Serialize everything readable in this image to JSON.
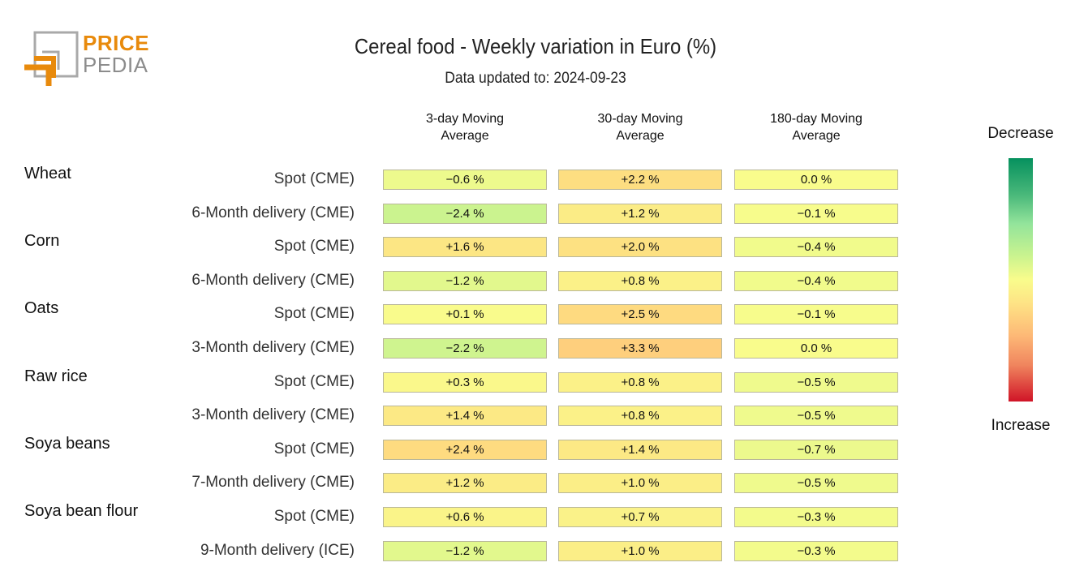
{
  "logo": {
    "line1": "PRICE",
    "line2": "PEDIA"
  },
  "chart_data": {
    "type": "heatmap",
    "title": "Cereal food - Weekly variation in Euro (%)",
    "subtitle": "Data updated to: 2024-09-23",
    "columns": [
      "3-day Moving\nAverage",
      "30-day Moving\nAverage",
      "180-day Moving\nAverage"
    ],
    "column_lines": [
      [
        "3-day Moving",
        "Average"
      ],
      [
        "30-day Moving",
        "Average"
      ],
      [
        "180-day Moving",
        "Average"
      ]
    ],
    "groups": [
      {
        "name": "Wheat",
        "rows": [
          0,
          1
        ]
      },
      {
        "name": "Corn",
        "rows": [
          2,
          3
        ]
      },
      {
        "name": "Oats",
        "rows": [
          4,
          5
        ]
      },
      {
        "name": "Raw rice",
        "rows": [
          6,
          7
        ]
      },
      {
        "name": "Soya beans",
        "rows": [
          8,
          9
        ]
      },
      {
        "name": "Soya bean flour",
        "rows": [
          10,
          11
        ]
      }
    ],
    "rows": [
      {
        "label": "Spot (CME)",
        "values": [
          -0.6,
          2.2,
          0.0
        ],
        "text": [
          "−0.6 %",
          "+2.2 %",
          "0.0 %"
        ]
      },
      {
        "label": "6-Month delivery (CME)",
        "values": [
          -2.4,
          1.2,
          -0.1
        ],
        "text": [
          "−2.4 %",
          "+1.2 %",
          "−0.1 %"
        ]
      },
      {
        "label": "Spot (CME)",
        "values": [
          1.6,
          2.0,
          -0.4
        ],
        "text": [
          "+1.6 %",
          "+2.0 %",
          "−0.4 %"
        ]
      },
      {
        "label": "6-Month delivery (CME)",
        "values": [
          -1.2,
          0.8,
          -0.4
        ],
        "text": [
          "−1.2 %",
          "+0.8 %",
          "−0.4 %"
        ]
      },
      {
        "label": "Spot (CME)",
        "values": [
          0.1,
          2.5,
          -0.1
        ],
        "text": [
          "+0.1 %",
          "+2.5 %",
          "−0.1 %"
        ]
      },
      {
        "label": "3-Month delivery (CME)",
        "values": [
          -2.2,
          3.3,
          0.0
        ],
        "text": [
          "−2.2 %",
          "+3.3 %",
          "0.0 %"
        ]
      },
      {
        "label": "Spot (CME)",
        "values": [
          0.3,
          0.8,
          -0.5
        ],
        "text": [
          "+0.3 %",
          "+0.8 %",
          "−0.5 %"
        ]
      },
      {
        "label": "3-Month delivery (CME)",
        "values": [
          1.4,
          0.8,
          -0.5
        ],
        "text": [
          "+1.4 %",
          "+0.8 %",
          "−0.5 %"
        ]
      },
      {
        "label": "Spot (CME)",
        "values": [
          2.4,
          1.4,
          -0.7
        ],
        "text": [
          "+2.4 %",
          "+1.4 %",
          "−0.7 %"
        ]
      },
      {
        "label": "7-Month delivery (CME)",
        "values": [
          1.2,
          1.0,
          -0.5
        ],
        "text": [
          "+1.2 %",
          "+1.0 %",
          "−0.5 %"
        ]
      },
      {
        "label": "Spot (CME)",
        "values": [
          0.6,
          0.7,
          -0.3
        ],
        "text": [
          "+0.6 %",
          "+0.7 %",
          "−0.3 %"
        ]
      },
      {
        "label": "9-Month delivery (ICE)",
        "values": [
          -1.2,
          1.0,
          -0.3
        ],
        "text": [
          "−1.2 %",
          "+1.0 %",
          "−0.3 %"
        ]
      }
    ],
    "colorscale": {
      "top_label": "Decrease",
      "bottom_label": "Increase",
      "colors": [
        "#06915e",
        "#93e49b",
        "#f9fc8c",
        "#fdb876",
        "#d01427"
      ],
      "range": [
        -10,
        10
      ]
    }
  }
}
